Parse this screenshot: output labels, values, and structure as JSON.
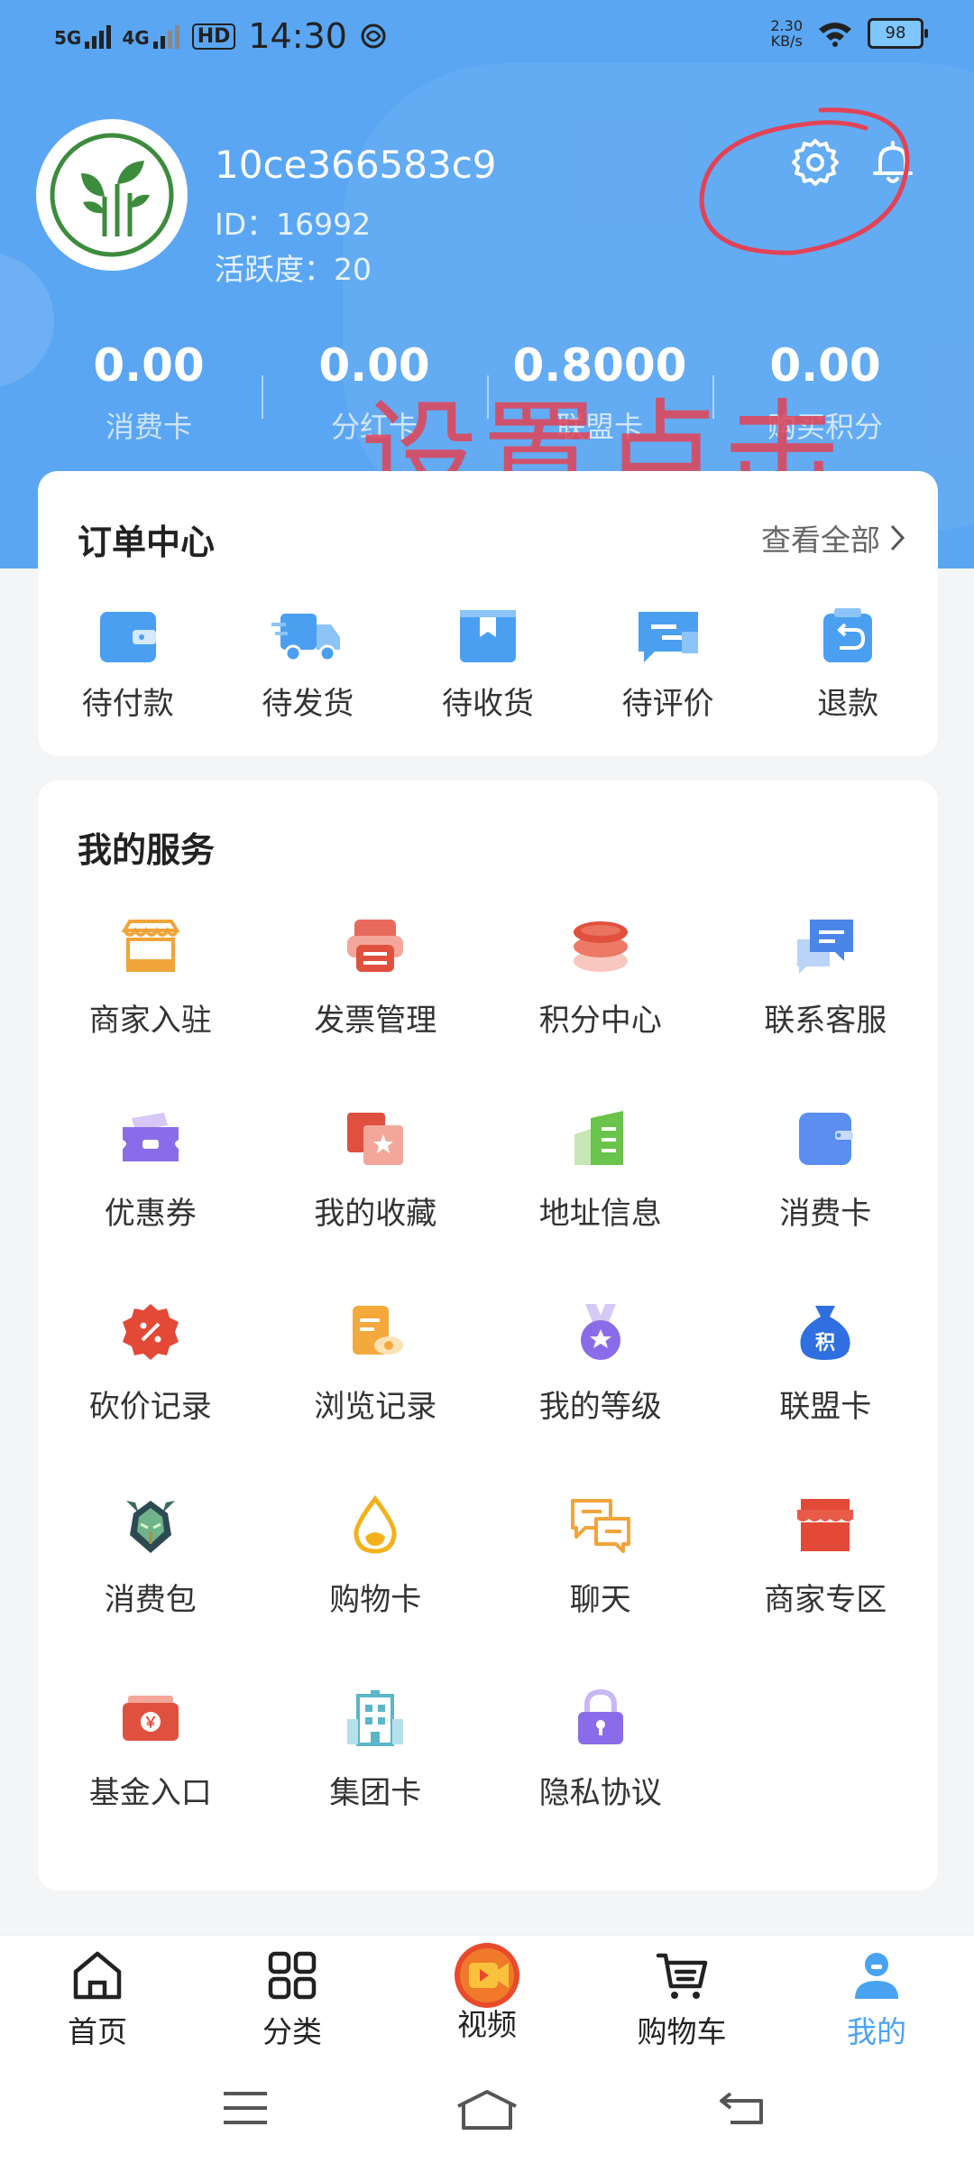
{
  "status_bar": {
    "network_1": "5G",
    "network_2": "4G",
    "hd": "HD",
    "time": "14:30",
    "speed_value": "2.30",
    "speed_unit": "KB/s",
    "battery": "98"
  },
  "profile": {
    "username": "10ce366583c9",
    "id_text": "ID：16992",
    "activity_text": "活跃度：20"
  },
  "stats": [
    {
      "value": "0.00",
      "label": "消费卡"
    },
    {
      "value": "0.00",
      "label": "分红卡"
    },
    {
      "value": "0.8000",
      "label": "联盟卡"
    },
    {
      "value": "0.00",
      "label": "购买积分"
    }
  ],
  "annotation_text": "设置点击",
  "orders": {
    "title": "订单中心",
    "view_all": "查看全部",
    "items": [
      {
        "label": "待付款",
        "icon": "wallet-icon"
      },
      {
        "label": "待发货",
        "icon": "truck-icon"
      },
      {
        "label": "待收货",
        "icon": "package-icon"
      },
      {
        "label": "待评价",
        "icon": "comment-icon"
      },
      {
        "label": "退款",
        "icon": "refund-icon"
      }
    ]
  },
  "services": {
    "title": "我的服务",
    "items": [
      {
        "label": "商家入驻",
        "icon": "storefront-icon"
      },
      {
        "label": "发票管理",
        "icon": "invoice-icon"
      },
      {
        "label": "积分中心",
        "icon": "coins-icon"
      },
      {
        "label": "联系客服",
        "icon": "chat-bubble-icon"
      },
      {
        "label": "优惠券",
        "icon": "coupon-icon"
      },
      {
        "label": "我的收藏",
        "icon": "favorite-icon"
      },
      {
        "label": "地址信息",
        "icon": "address-book-icon"
      },
      {
        "label": "消费卡",
        "icon": "card-icon"
      },
      {
        "label": "砍价记录",
        "icon": "discount-badge-icon"
      },
      {
        "label": "浏览记录",
        "icon": "history-doc-icon"
      },
      {
        "label": "我的等级",
        "icon": "medal-icon"
      },
      {
        "label": "联盟卡",
        "icon": "money-bag-icon"
      },
      {
        "label": "消费包",
        "icon": "hero-avatar-icon"
      },
      {
        "label": "购物卡",
        "icon": "drop-icon"
      },
      {
        "label": "聊天",
        "icon": "chat-icon"
      },
      {
        "label": "商家专区",
        "icon": "shop-icon"
      },
      {
        "label": "基金入口",
        "icon": "fund-icon"
      },
      {
        "label": "集团卡",
        "icon": "building-icon"
      },
      {
        "label": "隐私协议",
        "icon": "lock-icon"
      }
    ],
    "money_bag_glyph": "积",
    "fund_glyph": "￥"
  },
  "tabbar": [
    {
      "label": "首页",
      "icon": "home-icon"
    },
    {
      "label": "分类",
      "icon": "category-icon"
    },
    {
      "label": "视频",
      "icon": "video-icon"
    },
    {
      "label": "购物车",
      "icon": "cart-icon"
    },
    {
      "label": "我的",
      "icon": "profile-icon"
    }
  ],
  "colors": {
    "header_blue": "#5aa6f2",
    "active_tab": "#4aa3f0",
    "annotation_red": "#e24256"
  }
}
